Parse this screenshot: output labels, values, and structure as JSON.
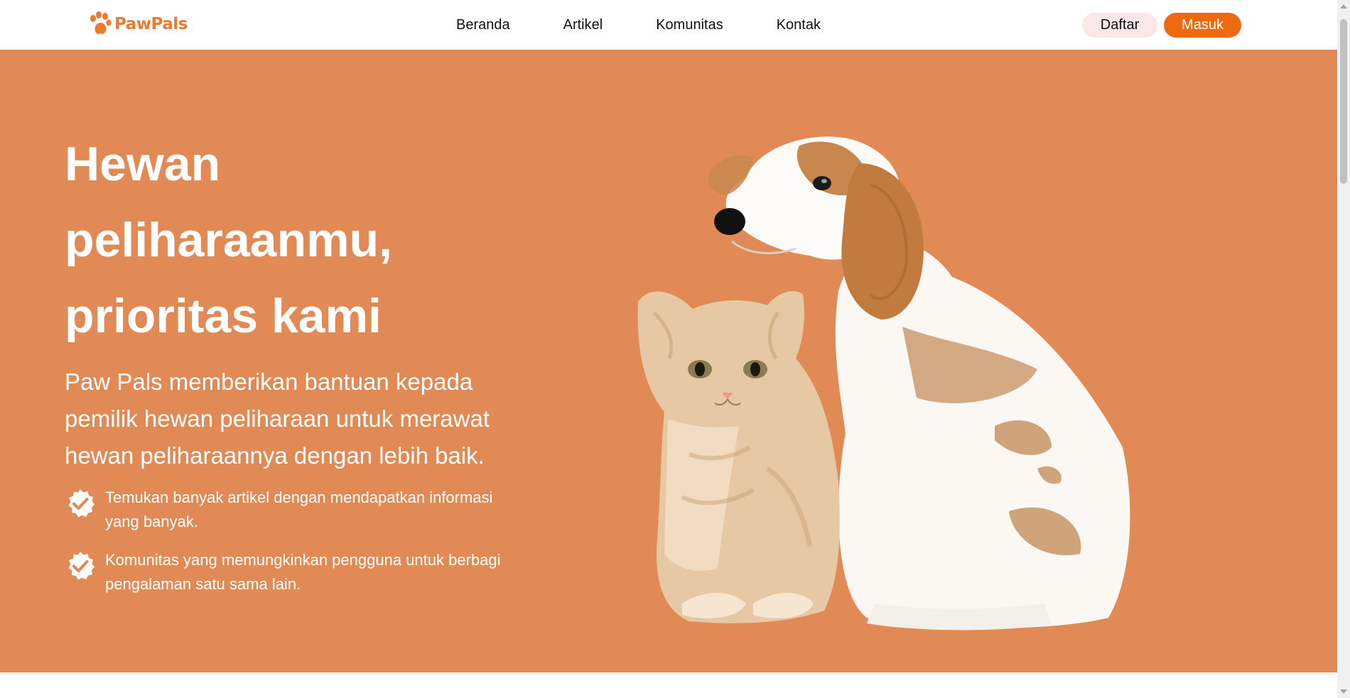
{
  "brand": {
    "name": "PawPals",
    "accent": "#ee6a10",
    "hero_background": "#e28a55",
    "logo_icon": "paw-icon"
  },
  "nav": {
    "items": [
      {
        "label": "Beranda"
      },
      {
        "label": "Artikel"
      },
      {
        "label": "Komunitas"
      },
      {
        "label": "Kontak"
      }
    ],
    "daftar_label": "Daftar",
    "masuk_label": "Masuk"
  },
  "hero": {
    "title_lines": [
      "Hewan",
      "peliharaanmu,",
      "prioritas kami"
    ],
    "description": "Paw Pals memberikan bantuan kepada pemilik hewan peliharaan untuk merawat hewan peliharaannya dengan lebih baik.",
    "features": [
      {
        "icon": "verified-badge-icon",
        "text": "Temukan banyak artikel dengan mendapatkan informasi yang banyak."
      },
      {
        "icon": "verified-badge-icon",
        "text": "Komunitas yang memungkinkan pengguna untuk berbagi pengalaman satu sama lain."
      }
    ],
    "image": "kitten-and-puppy-illustration"
  }
}
